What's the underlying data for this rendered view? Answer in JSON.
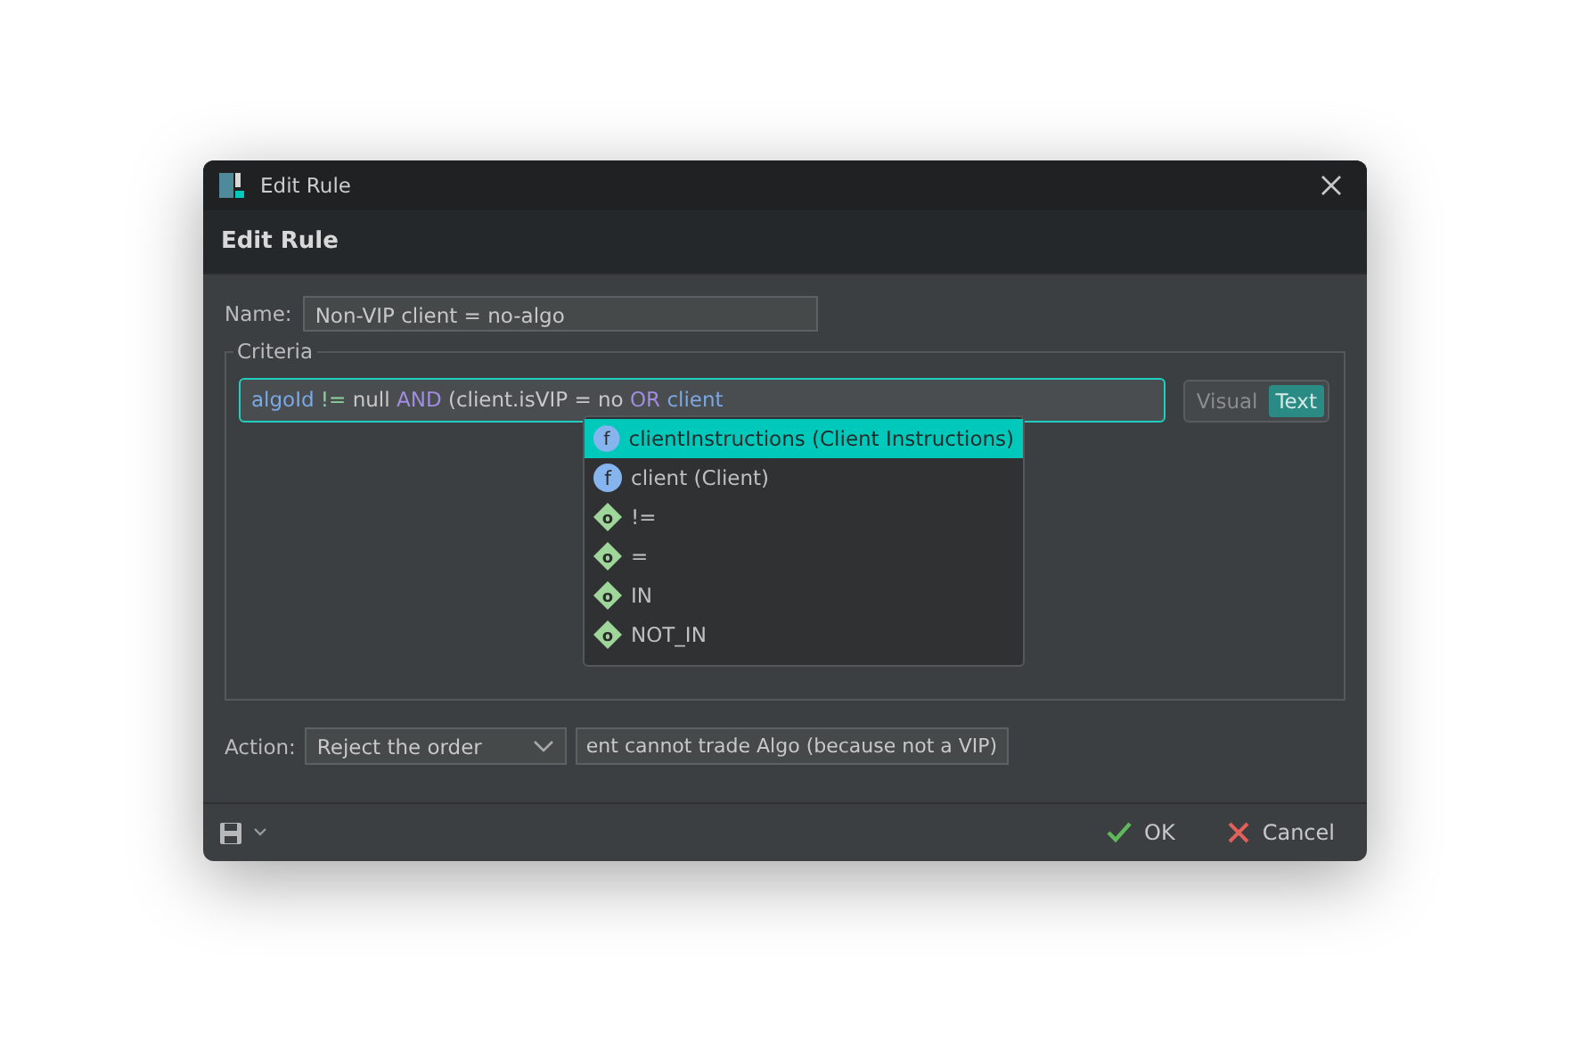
{
  "window": {
    "title": "Edit Rule"
  },
  "header": {
    "title": "Edit Rule"
  },
  "name": {
    "label": "Name:",
    "value": "Non-VIP client = no-algo"
  },
  "criteria": {
    "title": "Criteria",
    "expression": [
      {
        "kind": "ident",
        "text": "algoId"
      },
      {
        "kind": "op",
        "text": " != "
      },
      {
        "kind": "plain",
        "text": "null "
      },
      {
        "kind": "keyword",
        "text": "AND"
      },
      {
        "kind": "plain",
        "text": " (client.isVIP = no "
      },
      {
        "kind": "keyword",
        "text": "OR"
      },
      {
        "kind": "ident",
        "text": " client"
      }
    ],
    "modes": [
      {
        "label": "Visual",
        "selected": false
      },
      {
        "label": "Text",
        "selected": true
      }
    ],
    "suggestions": [
      {
        "kind": "field",
        "badge": "f",
        "text": "clientInstructions (Client Instructions)",
        "selected": true
      },
      {
        "kind": "field",
        "badge": "f",
        "text": "client (Client)",
        "selected": false
      },
      {
        "kind": "operator",
        "badge": "o",
        "text": "!=",
        "selected": false
      },
      {
        "kind": "operator",
        "badge": "o",
        "text": "=",
        "selected": false
      },
      {
        "kind": "operator",
        "badge": "o",
        "text": "IN",
        "selected": false
      },
      {
        "kind": "operator",
        "badge": "o",
        "text": "NOT_IN",
        "selected": false
      }
    ]
  },
  "action": {
    "label": "Action:",
    "choice": "Reject the order",
    "message": "ent cannot trade Algo (because not a VIP)"
  },
  "buttons": [
    {
      "kind": "ok",
      "label": "OK"
    },
    {
      "kind": "cancel",
      "label": "Cancel"
    }
  ]
}
